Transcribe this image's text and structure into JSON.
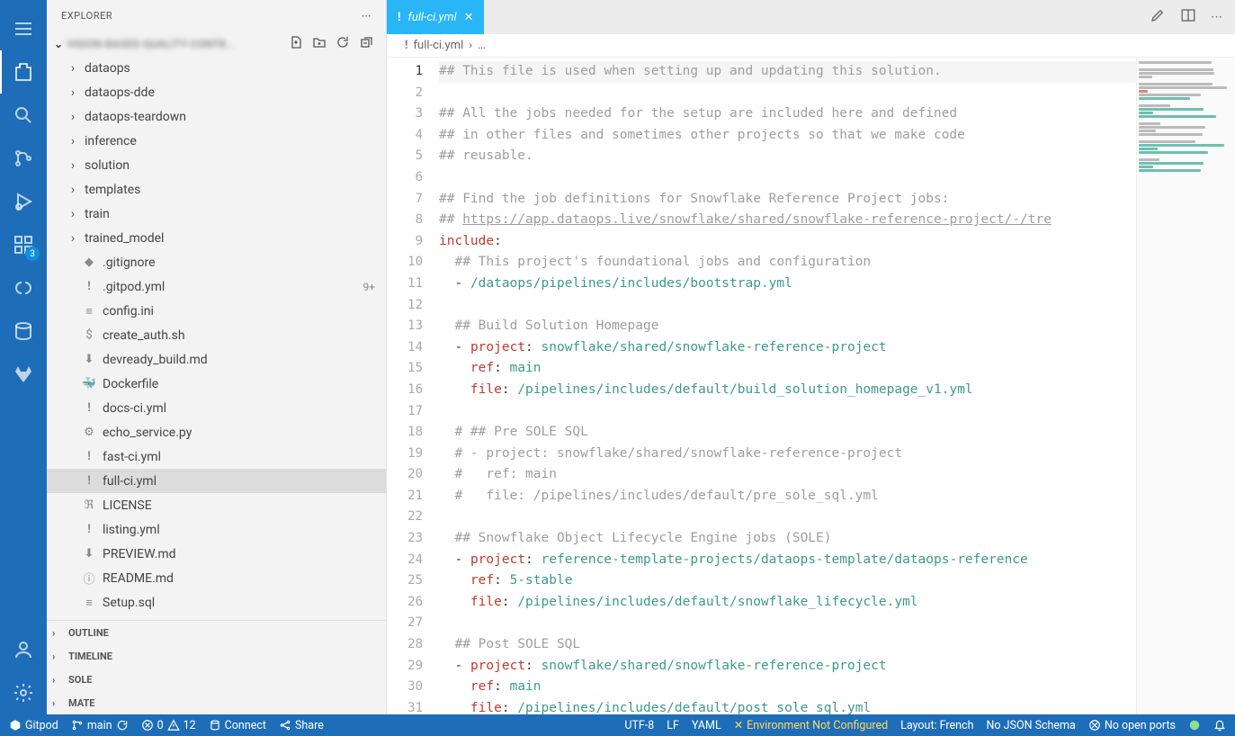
{
  "sidebar": {
    "title": "EXPLORER",
    "root_label": "VISION-BASED-QUALITY-CONTR...",
    "folders": [
      {
        "label": "dataops"
      },
      {
        "label": "dataops-dde"
      },
      {
        "label": "dataops-teardown"
      },
      {
        "label": "inference"
      },
      {
        "label": "solution"
      },
      {
        "label": "templates"
      },
      {
        "label": "train"
      },
      {
        "label": "trained_model"
      }
    ],
    "files": [
      {
        "label": ".gitignore",
        "icon": "◆",
        "cls": "icon-git"
      },
      {
        "label": ".gitpod.yml",
        "icon": "!",
        "cls": "icon-yml",
        "hint": "9+"
      },
      {
        "label": "config.ini",
        "icon": "≡",
        "cls": "icon-txt"
      },
      {
        "label": "create_auth.sh",
        "icon": "$",
        "cls": "icon-sh"
      },
      {
        "label": "devready_build.md",
        "icon": "⬇",
        "cls": "icon-md"
      },
      {
        "label": "Dockerfile",
        "icon": "🐳",
        "cls": "icon-docker"
      },
      {
        "label": "docs-ci.yml",
        "icon": "!",
        "cls": "icon-yml"
      },
      {
        "label": "echo_service.py",
        "icon": "⚙",
        "cls": "icon-py"
      },
      {
        "label": "fast-ci.yml",
        "icon": "!",
        "cls": "icon-yml"
      },
      {
        "label": "full-ci.yml",
        "icon": "!",
        "cls": "icon-yml",
        "selected": true
      },
      {
        "label": "LICENSE",
        "icon": "ℜ",
        "cls": "icon-lic"
      },
      {
        "label": "listing.yml",
        "icon": "!",
        "cls": "icon-yml"
      },
      {
        "label": "PREVIEW.md",
        "icon": "⬇",
        "cls": "icon-md"
      },
      {
        "label": "README.md",
        "icon": "ⓘ",
        "cls": "icon-info"
      },
      {
        "label": "Setup.sql",
        "icon": "≡",
        "cls": "icon-txt"
      }
    ],
    "sections": [
      {
        "label": "OUTLINE"
      },
      {
        "label": "TIMELINE"
      },
      {
        "label": "SOLE"
      },
      {
        "label": "MATE"
      }
    ]
  },
  "activity_badge": "3",
  "tab": {
    "icon": "!",
    "label": "full-ci.yml"
  },
  "breadcrumb": {
    "file": "full-ci.yml",
    "rest": "…"
  },
  "code_lines": [
    {
      "n": 1,
      "hl": true,
      "segs": [
        {
          "c": "c-comment",
          "t": "## This file is used when setting up and updating this solution."
        }
      ]
    },
    {
      "n": 2,
      "segs": []
    },
    {
      "n": 3,
      "segs": [
        {
          "c": "c-comment",
          "t": "## All the jobs needed for the setup are included here and defined"
        }
      ]
    },
    {
      "n": 4,
      "segs": [
        {
          "c": "c-comment",
          "t": "## in other files and sometimes other projects so that we make code"
        }
      ]
    },
    {
      "n": 5,
      "segs": [
        {
          "c": "c-comment",
          "t": "## reusable."
        }
      ]
    },
    {
      "n": 6,
      "segs": []
    },
    {
      "n": 7,
      "segs": [
        {
          "c": "c-comment",
          "t": "## Find the job definitions for Snowflake Reference Project jobs:"
        }
      ]
    },
    {
      "n": 8,
      "segs": [
        {
          "c": "c-comment",
          "t": "## "
        },
        {
          "c": "c-link",
          "t": "https://app.dataops.live/snowflake/shared/snowflake-reference-project/-/tre"
        }
      ]
    },
    {
      "n": 9,
      "segs": [
        {
          "c": "c-key",
          "t": "include"
        },
        {
          "c": "c-punct",
          "t": ":"
        }
      ]
    },
    {
      "n": 10,
      "segs": [
        {
          "t": "  "
        },
        {
          "c": "c-comment",
          "t": "## This project's foundational jobs and configuration"
        }
      ]
    },
    {
      "n": 11,
      "segs": [
        {
          "t": "  "
        },
        {
          "c": "c-punct",
          "t": "- "
        },
        {
          "c": "c-str",
          "t": "/dataops/pipelines/includes/bootstrap.yml"
        }
      ]
    },
    {
      "n": 12,
      "segs": []
    },
    {
      "n": 13,
      "segs": [
        {
          "t": "  "
        },
        {
          "c": "c-comment",
          "t": "## Build Solution Homepage"
        }
      ]
    },
    {
      "n": 14,
      "segs": [
        {
          "t": "  "
        },
        {
          "c": "c-punct",
          "t": "- "
        },
        {
          "c": "c-key",
          "t": "project"
        },
        {
          "c": "c-punct",
          "t": ": "
        },
        {
          "c": "c-str",
          "t": "snowflake/shared/snowflake-reference-project"
        }
      ]
    },
    {
      "n": 15,
      "segs": [
        {
          "t": "    "
        },
        {
          "c": "c-key",
          "t": "ref"
        },
        {
          "c": "c-punct",
          "t": ": "
        },
        {
          "c": "c-str",
          "t": "main"
        }
      ]
    },
    {
      "n": 16,
      "segs": [
        {
          "t": "    "
        },
        {
          "c": "c-key",
          "t": "file"
        },
        {
          "c": "c-punct",
          "t": ": "
        },
        {
          "c": "c-str",
          "t": "/pipelines/includes/default/build_solution_homepage_v1.yml"
        }
      ]
    },
    {
      "n": 17,
      "segs": []
    },
    {
      "n": 18,
      "segs": [
        {
          "t": "  "
        },
        {
          "c": "c-comment",
          "t": "# ## Pre SOLE SQL"
        }
      ]
    },
    {
      "n": 19,
      "segs": [
        {
          "t": "  "
        },
        {
          "c": "c-comment",
          "t": "# - project: snowflake/shared/snowflake-reference-project"
        }
      ]
    },
    {
      "n": 20,
      "segs": [
        {
          "t": "  "
        },
        {
          "c": "c-comment",
          "t": "#   ref: main"
        }
      ]
    },
    {
      "n": 21,
      "segs": [
        {
          "t": "  "
        },
        {
          "c": "c-comment",
          "t": "#   file: /pipelines/includes/default/pre_sole_sql.yml"
        }
      ]
    },
    {
      "n": 22,
      "segs": []
    },
    {
      "n": 23,
      "segs": [
        {
          "t": "  "
        },
        {
          "c": "c-comment",
          "t": "## Snowflake Object Lifecycle Engine jobs (SOLE)"
        }
      ]
    },
    {
      "n": 24,
      "segs": [
        {
          "t": "  "
        },
        {
          "c": "c-punct",
          "t": "- "
        },
        {
          "c": "c-key",
          "t": "project"
        },
        {
          "c": "c-punct",
          "t": ": "
        },
        {
          "c": "c-str",
          "t": "reference-template-projects/dataops-template/dataops-reference"
        }
      ]
    },
    {
      "n": 25,
      "segs": [
        {
          "t": "    "
        },
        {
          "c": "c-key",
          "t": "ref"
        },
        {
          "c": "c-punct",
          "t": ": "
        },
        {
          "c": "c-str",
          "t": "5-stable"
        }
      ]
    },
    {
      "n": 26,
      "segs": [
        {
          "t": "    "
        },
        {
          "c": "c-key",
          "t": "file"
        },
        {
          "c": "c-punct",
          "t": ": "
        },
        {
          "c": "c-str",
          "t": "/pipelines/includes/default/snowflake_lifecycle.yml"
        }
      ]
    },
    {
      "n": 27,
      "segs": []
    },
    {
      "n": 28,
      "segs": [
        {
          "t": "  "
        },
        {
          "c": "c-comment",
          "t": "## Post SOLE SQL"
        }
      ]
    },
    {
      "n": 29,
      "segs": [
        {
          "t": "  "
        },
        {
          "c": "c-punct",
          "t": "- "
        },
        {
          "c": "c-key",
          "t": "project"
        },
        {
          "c": "c-punct",
          "t": ": "
        },
        {
          "c": "c-str",
          "t": "snowflake/shared/snowflake-reference-project"
        }
      ]
    },
    {
      "n": 30,
      "segs": [
        {
          "t": "    "
        },
        {
          "c": "c-key",
          "t": "ref"
        },
        {
          "c": "c-punct",
          "t": ": "
        },
        {
          "c": "c-str",
          "t": "main"
        }
      ]
    },
    {
      "n": 31,
      "segs": [
        {
          "t": "    "
        },
        {
          "c": "c-key",
          "t": "file"
        },
        {
          "c": "c-punct",
          "t": ": "
        },
        {
          "c": "c-str",
          "t": "/pipelines/includes/default/post_sole_sql.yml"
        }
      ]
    }
  ],
  "status": {
    "gitpod": "Gitpod",
    "branch": "main",
    "errors": "0",
    "warnings": "12",
    "connect": "Connect",
    "share": "Share",
    "encoding": "UTF-8",
    "eol": "LF",
    "lang": "YAML",
    "env": "Environment Not Configured",
    "layout": "Layout: French",
    "schema": "No JSON Schema",
    "ports": "No open ports"
  }
}
